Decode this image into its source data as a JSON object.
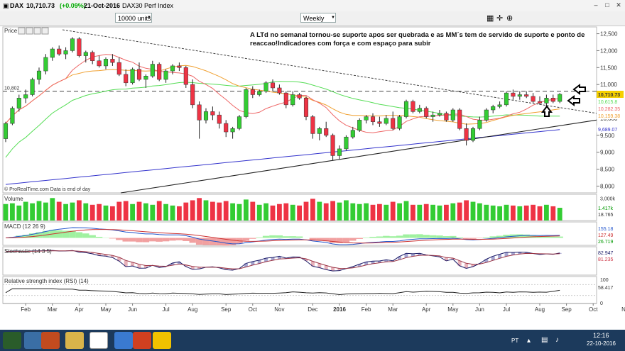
{
  "window": {
    "symbol": "DAX",
    "price": "10,710.73",
    "change": "(+0.09%)",
    "date": "21-Oct-2016",
    "index_name": "DAX30 Perf Index"
  },
  "toolbar": {
    "units": "10000 units",
    "timeframe": "Weekly"
  },
  "colors": {
    "up": "#33cc33",
    "down": "#ee3344",
    "ma_short": "#ee6666",
    "ma_mid": "#f0a030",
    "ma_long": "#55dd55",
    "ma_xlong": "#3333cc",
    "macd_hist_pos": "#88ee88",
    "macd_hist_neg": "#ee8888",
    "stoch_fill_up": "#3a3a99",
    "stoch_fill_down": "#cc5566"
  },
  "chart_data": {
    "type": "candlestick",
    "frequency": "weekly",
    "price_panel": {
      "label": "Price",
      "ylim": [
        7800,
        12700
      ],
      "yticks": [
        8000,
        8500,
        9000,
        9500,
        10000,
        10500,
        11000,
        11500,
        12000,
        12500
      ],
      "ytick_labels": [
        "8,000",
        "8,500",
        "9,000",
        "9,500",
        "10,000",
        "10,500",
        "11,000",
        "11,500",
        "12,000",
        "12,500"
      ],
      "reference_line": 10802,
      "reference_label": "10,802",
      "last_price_label": "10,710.73",
      "ma_labels": [
        "10,615.8",
        "10,282.35",
        "10,159.38",
        "9,689.07"
      ],
      "ma_label_values": [
        10615.8,
        10282.35,
        10159.38,
        9689.07
      ],
      "annotation": "A LTd no semanal tornou-se suporte apos ser quebrada e as MM´s tem de servido de suporte e ponto de reaccao!Indicadores com força e com espaço para subir",
      "source_note": "© ProRealTime.com  Data is end of day",
      "candles": [
        [
          9400,
          9900,
          9300,
          9850
        ],
        [
          9850,
          10350,
          9800,
          10300
        ],
        [
          10300,
          10700,
          10200,
          10600
        ],
        [
          10600,
          10850,
          10450,
          10700
        ],
        [
          10700,
          11200,
          10650,
          11150
        ],
        [
          11150,
          11500,
          11000,
          11400
        ],
        [
          11400,
          11900,
          11300,
          11800
        ],
        [
          11800,
          12100,
          11700,
          12050
        ],
        [
          12050,
          12150,
          11850,
          11900
        ],
        [
          11900,
          12100,
          11750,
          12000
        ],
        [
          12000,
          12400,
          11950,
          12350
        ],
        [
          12350,
          12400,
          11800,
          11850
        ],
        [
          11850,
          12000,
          11650,
          11950
        ],
        [
          11950,
          12000,
          11600,
          11700
        ],
        [
          11700,
          11850,
          11500,
          11550
        ],
        [
          11550,
          11800,
          11450,
          11750
        ],
        [
          11750,
          11900,
          11550,
          11650
        ],
        [
          11650,
          11800,
          11250,
          11300
        ],
        [
          11300,
          11450,
          10950,
          11050
        ],
        [
          11050,
          11500,
          11000,
          11450
        ],
        [
          11450,
          11650,
          11100,
          11150
        ],
        [
          11150,
          11300,
          10900,
          11250
        ],
        [
          11250,
          11700,
          11200,
          11600
        ],
        [
          11600,
          11650,
          11100,
          11150
        ],
        [
          11150,
          11450,
          11050,
          11400
        ],
        [
          11400,
          11600,
          11300,
          11550
        ],
        [
          11550,
          11650,
          11400,
          11500
        ],
        [
          11500,
          11550,
          10900,
          11000
        ],
        [
          11000,
          11150,
          10300,
          10400
        ],
        [
          10400,
          10500,
          9400,
          9950
        ],
        [
          9950,
          10300,
          9850,
          10200
        ],
        [
          10200,
          10350,
          9950,
          10100
        ],
        [
          10100,
          10200,
          9700,
          9850
        ],
        [
          9850,
          9950,
          9450,
          9600
        ],
        [
          9600,
          9750,
          9400,
          9700
        ],
        [
          9700,
          10100,
          9650,
          10050
        ],
        [
          10050,
          10900,
          10000,
          10850
        ],
        [
          10850,
          10950,
          10600,
          10700
        ],
        [
          10700,
          10850,
          10650,
          10800
        ],
        [
          10800,
          11100,
          10750,
          11050
        ],
        [
          11050,
          11150,
          10800,
          10900
        ],
        [
          10900,
          11000,
          10700,
          10750
        ],
        [
          10750,
          10800,
          10300,
          10400
        ],
        [
          10400,
          10800,
          10350,
          10700
        ],
        [
          10700,
          10750,
          10550,
          10600
        ],
        [
          10600,
          10650,
          9950,
          10050
        ],
        [
          10050,
          10100,
          9400,
          9550
        ],
        [
          9550,
          9750,
          9350,
          9700
        ],
        [
          9700,
          9900,
          9450,
          9500
        ],
        [
          9500,
          9550,
          8750,
          8900
        ],
        [
          8900,
          9200,
          8800,
          9100
        ],
        [
          9100,
          9500,
          9050,
          9450
        ],
        [
          9450,
          9750,
          9400,
          9650
        ],
        [
          9650,
          10000,
          9600,
          9950
        ],
        [
          9950,
          10100,
          9850,
          10050
        ],
        [
          10050,
          10150,
          9800,
          9900
        ],
        [
          9900,
          10050,
          9750,
          9850
        ],
        [
          9850,
          10100,
          9800,
          10000
        ],
        [
          10000,
          10200,
          9650,
          9700
        ],
        [
          9700,
          10100,
          9650,
          10050
        ],
        [
          10050,
          10550,
          10000,
          10500
        ],
        [
          10500,
          10550,
          10150,
          10200
        ],
        [
          10200,
          10400,
          10150,
          10300
        ],
        [
          10300,
          10350,
          10000,
          10050
        ],
        [
          10050,
          10200,
          9900,
          10100
        ],
        [
          10100,
          10250,
          10050,
          10150
        ],
        [
          10150,
          10200,
          9900,
          9950
        ],
        [
          9950,
          10300,
          9900,
          10250
        ],
        [
          10250,
          10300,
          9650,
          9700
        ],
        [
          9700,
          9850,
          9200,
          9350
        ],
        [
          9350,
          9750,
          9300,
          9700
        ],
        [
          9700,
          10050,
          9650,
          9950
        ],
        [
          9950,
          10300,
          9900,
          10250
        ],
        [
          10250,
          10400,
          10150,
          10350
        ],
        [
          10350,
          10500,
          10300,
          10400
        ],
        [
          10400,
          10800,
          10350,
          10750
        ],
        [
          10750,
          10850,
          10550,
          10650
        ],
        [
          10650,
          10800,
          10550,
          10700
        ],
        [
          10700,
          10800,
          10600,
          10650
        ],
        [
          10650,
          10750,
          10450,
          10500
        ],
        [
          10500,
          10650,
          10400,
          10450
        ],
        [
          10450,
          10700,
          10350,
          10600
        ],
        [
          10600,
          10700,
          10450,
          10500
        ],
        [
          10500,
          10750,
          10450,
          10711
        ]
      ]
    },
    "x_axis": {
      "labels": [
        "Feb",
        "Mar",
        "Apr",
        "May",
        "Jun",
        "Jul",
        "Aug",
        "Sep",
        "Oct",
        "Nov",
        "Dec",
        "2016",
        "Feb",
        "Mar",
        "Apr",
        "May",
        "Jun",
        "Jul",
        "Aug",
        "Sep",
        "Oct",
        "Nov"
      ],
      "label_week_index": [
        3,
        7,
        11,
        15,
        19,
        24,
        28,
        33,
        37,
        41,
        46,
        50,
        54,
        58,
        63,
        67,
        71,
        75,
        80,
        84,
        88,
        93
      ]
    },
    "volume_panel": {
      "label": "Volume",
      "ylim": [
        0,
        3500
      ],
      "ytick_labels": [
        "3,000k"
      ],
      "value_labels": [
        "1.417k",
        "18.765"
      ],
      "values": [
        2200,
        2300,
        2000,
        2500,
        2300,
        2600,
        2400,
        3000,
        2500,
        2200,
        2400,
        2700,
        2300,
        2100,
        2200,
        2000,
        1900,
        2500,
        2600,
        2200,
        2500,
        2300,
        2100,
        2600,
        2200,
        2000,
        1900,
        2400,
        2700,
        3000,
        2700,
        2500,
        2400,
        2600,
        2300,
        2200,
        2800,
        2500,
        2100,
        2300,
        2000,
        2200,
        2300,
        2100,
        2000,
        2500,
        2900,
        2500,
        2300,
        2600,
        2400,
        2700,
        2300,
        2200,
        2300,
        2100,
        2200,
        2100,
        2500,
        2300,
        2600,
        2100,
        2100,
        2200,
        2100,
        2000,
        2100,
        2300,
        2400,
        2700,
        2500,
        2300,
        2100,
        2000,
        1900,
        2100,
        2000,
        1900,
        2000,
        2100,
        1900,
        2100,
        1900,
        1700
      ]
    },
    "macd_panel": {
      "label": "MACD (12 26 9)",
      "value_labels": [
        "155.18",
        "127.49",
        "26.719"
      ]
    },
    "stochastic_panel": {
      "label": "Stochastic (14 3 5)",
      "ylim": [
        0,
        100
      ],
      "value_labels": [
        "82.947",
        "81.235"
      ]
    },
    "rsi_panel": {
      "label": "Relative strength index (RSI) (14)",
      "ylim": [
        0,
        100
      ],
      "ytick_labels": [
        "100",
        "0"
      ],
      "value_labels": [
        "58.417"
      ]
    }
  },
  "taskbar": {
    "lang": "PT",
    "time": "12:16",
    "date": "22-10-2016"
  }
}
